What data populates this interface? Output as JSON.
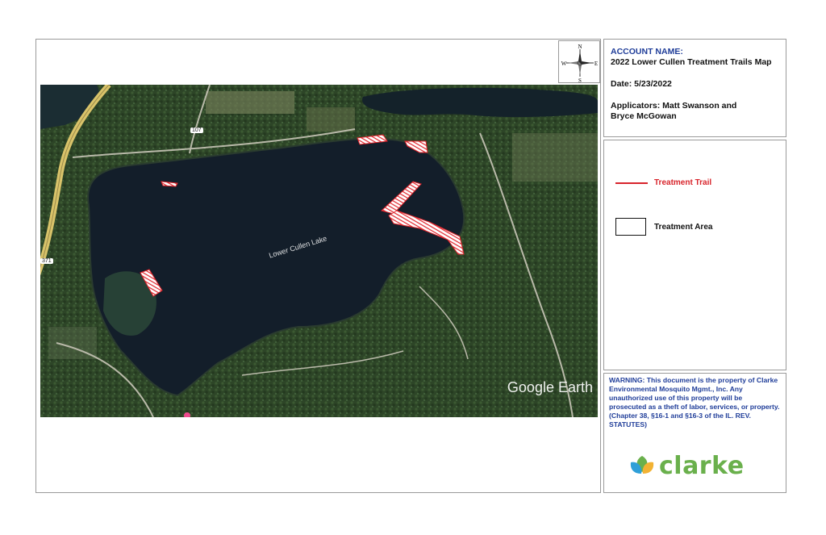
{
  "info": {
    "account_label": "ACCOUNT NAME:",
    "map_title": "2022 Lower Cullen Treatment Trails Map",
    "date": "Date: 5/23/2022",
    "applicators_line1": "Applicators: Matt Swanson and",
    "applicators_line2": "Bryce McGowan"
  },
  "compass": {
    "n": "N",
    "e": "E",
    "s": "S",
    "w": "W"
  },
  "legend": {
    "trail_label": "Treatment Trail",
    "area_label": "Treatment Area",
    "trail_color": "#d8242b"
  },
  "warning": {
    "text": "WARNING:  This document is the property of Clarke Environmental Mosquito Mgmt., Inc. Any unauthorized use of this property will be prosecuted as a theft of labor, services, or property.  (Chapter 38, §16-1 and §16-3 of the IL. REV. STATUTES)"
  },
  "logo": {
    "text": "clarke",
    "color": "#6ab04c"
  },
  "map": {
    "lake_name": "Lower Cullen Lake",
    "attribution": "Google Earth",
    "road_371": "371",
    "road_107": "107",
    "treatment_areas": 6
  }
}
